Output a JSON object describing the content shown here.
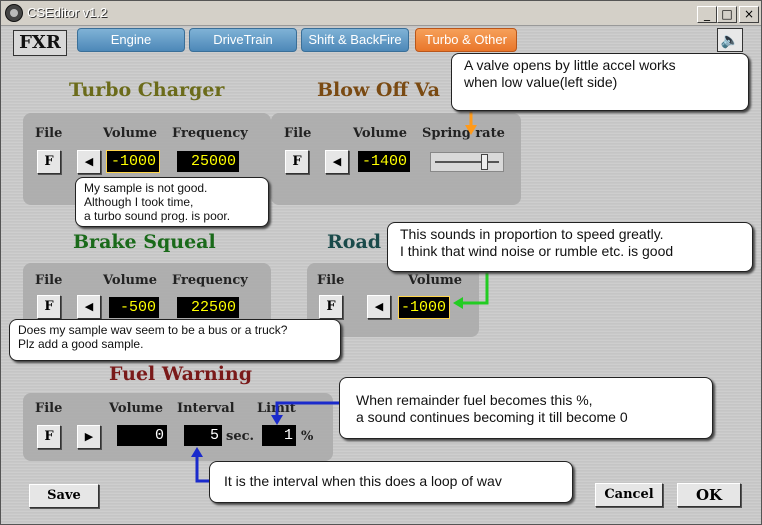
{
  "window": {
    "title": "CSEditor v1.2",
    "controls": {
      "minimize": "_",
      "maximize": "□",
      "close": "×"
    }
  },
  "logo": "FXR",
  "tabs": [
    {
      "label": "Engine",
      "active": false
    },
    {
      "label": "DriveTrain",
      "active": false
    },
    {
      "label": "Shift & BackFire",
      "active": false
    },
    {
      "label": "Turbo & Other",
      "active": true
    }
  ],
  "speaker_icon": "speaker-icon",
  "sections": {
    "turbo": {
      "heading": "Turbo Charger",
      "color": "#6b6b1a",
      "file_label": "File",
      "volume_label": "Volume",
      "frequency_label": "Frequency",
      "file_button": "F",
      "play": "◀",
      "volume": "-1000",
      "frequency": "25000"
    },
    "blowoff": {
      "heading": "Blow Off Va",
      "color": "#7a4a12",
      "file_label": "File",
      "volume_label": "Volume",
      "spring_label": "Spring rate",
      "file_button": "F",
      "play": "◀",
      "volume": "-1400",
      "spring_value": 0.8
    },
    "brake": {
      "heading": "Brake Squeal",
      "color": "#1a6a1a",
      "file_label": "File",
      "volume_label": "Volume",
      "frequency_label": "Frequency",
      "file_button": "F",
      "play": "◀",
      "volume": "-500",
      "frequency": "22500"
    },
    "road": {
      "heading": "Road",
      "color": "#1a4a4a",
      "file_label": "File",
      "volume_label": "Volume",
      "file_button": "F",
      "play": "◀",
      "volume": "-1000"
    },
    "fuel": {
      "heading": "Fuel Warning",
      "color": "#7a1a1a",
      "file_label": "File",
      "volume_label": "Volume",
      "interval_label": "Interval",
      "limit_label": "Limit",
      "file_button": "F",
      "play": "▶",
      "volume": "0",
      "interval": "5",
      "interval_unit": "sec.",
      "limit": "1",
      "limit_unit": "%"
    }
  },
  "callouts": {
    "valve": [
      "A valve opens by little accel works",
      "when low value(left side)"
    ],
    "turbo_sample": [
      "My sample is not good.",
      "Although I took time,",
      "a turbo sound prog. is poor."
    ],
    "road_sound": [
      "This sounds in proportion to speed greatly.",
      "I think that wind noise or rumble etc. is good"
    ],
    "brake_sample": [
      "Does my sample wav seem to be a bus or a truck?",
      "Plz add a good sample."
    ],
    "fuel_limit": [
      "When remainder fuel becomes this %,",
      "a sound continues becoming it till  become 0"
    ],
    "interval": [
      "It is the interval when this does a loop of wav"
    ]
  },
  "buttons": {
    "save": "Save",
    "cancel": "Cancel",
    "ok": "OK"
  },
  "colors": {
    "orange_arrow": "#ff9a1a",
    "green_arrow": "#22cc22",
    "blue_arrow": "#1a2acc"
  }
}
